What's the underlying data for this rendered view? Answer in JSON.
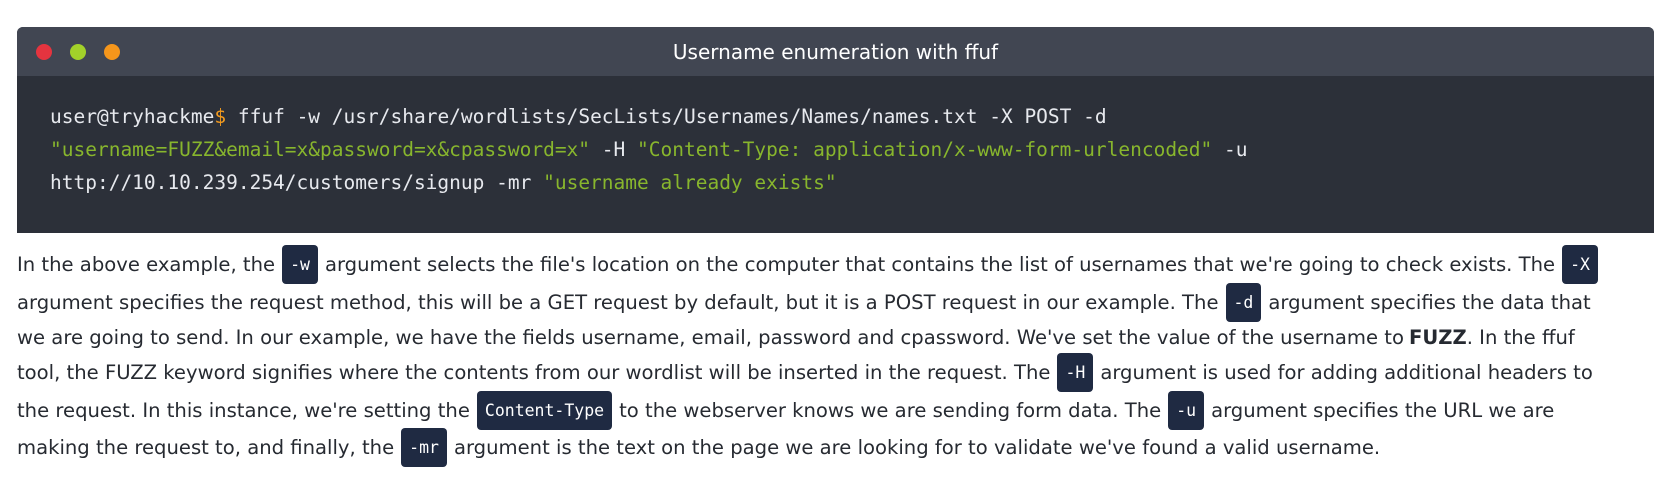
{
  "terminal": {
    "title": "Username enumeration with ffuf",
    "prompt_user": "user@tryhackme",
    "prompt_symbol": "$",
    "line1_cmd": " ffuf -w /usr/share/wordlists/SecLists/Usernames/Names/names.txt -X POST -d",
    "line2_str1": "\"username=FUZZ&email=x&password=x&cpassword=x\"",
    "line2_mid": " -H ",
    "line2_str2": "\"Content-Type: application/x-www-form-urlencoded\"",
    "line2_end": " -u",
    "line3_cmd": "http://10.10.239.254/customers/signup -mr ",
    "line3_str": "\"username already exists\"",
    "colors": {
      "bar": "#414652",
      "body": "#2c3039",
      "close": "#e5343f",
      "minimize": "#a2d12a",
      "maximize": "#f5961b",
      "prompt": "#f29a1e",
      "string": "#88b62d"
    }
  },
  "paragraph": {
    "l1_a": "In the above example, the",
    "code_w": "-w",
    "l1_b": "argument selects the file's location on the computer that contains the list of usernames that we're going to check exists. The",
    "code_X": "-X",
    "l2_a": "argument specifies the request method, this will be a GET request by default, but it is a POST request in our example. The",
    "code_d": "-d",
    "l2_b": "argument specifies the data that",
    "l3_a": "we are going to send. In our example, we have the fields username, email, password and cpassword. We've set the value of the username to",
    "l3_bold": "FUZZ",
    "l3_b": ". In the ffuf",
    "l4_a": "tool, the FUZZ keyword signifies where the contents from our wordlist will be inserted in the request. The",
    "code_H": "-H",
    "l4_b": "argument is used for adding additional headers to",
    "l5_a": "the request. In this instance, we're setting the",
    "code_ct": "Content-Type",
    "l5_b": "to the webserver knows we are sending form data. The",
    "code_u": "-u",
    "l5_c": "argument specifies the URL we are",
    "l6_a": "making the request to, and finally, the",
    "code_mr": "-mr",
    "l6_b": "argument is the text on the page we are looking for to validate we've found a valid username."
  }
}
